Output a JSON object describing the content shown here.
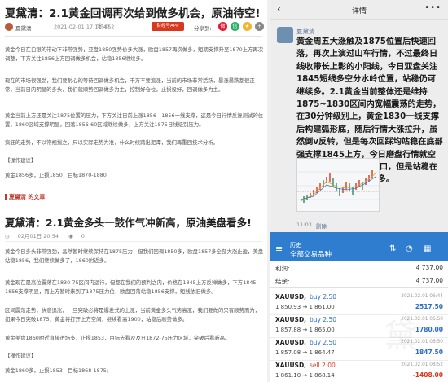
{
  "article1": {
    "title": "夏黛清：2.1黄金回调再次给到做多机会，原油待空!",
    "author": "夏黛清",
    "date": "2021-02-01 17:12:47",
    "views": "452",
    "app_button": "财经号APP",
    "share_label": "分享到:",
    "paragraphs": [
      "黄金今日在白银的带动下非常强势，亚盘1850强势价多大涨，欧盘1857再次做多，短期支撑升至1870上方再次调整，下方关注1856上方回调做多机会，站稳1856继续多。",
      "现在的市场很强劲，我们要耐心的等待回调做多机会，千万不要追涨，当前的市场非常活跃，暴涨暴跌都很正常，当前日内明显的多头，我们就顺势回调做多为主，控制好仓位，止损设好，回调做多为主。",
      "黄金当前上方还是关注1875位置的压力，下方关注日前上涨1856—1856一线支撑，这是今日行情反复测试的位置，1860区域支撑明显，回落1856-60区域继续做多，上方关注1875日线级别压力。",
      "疯狂的走势，不以常规揣之，只以实际走势为准，什么时候踏出泥潭，我们再重回技术分析。",
      "【操作建议】",
      "黄金1856多，止损1850，目标1870-1880；"
    ]
  },
  "section_header": "夏黛清 的文章",
  "article2": {
    "title": "夏黛清：2.1黄金多头一鼓作气冲新高，原油美盘看多!",
    "date": "02月01日 20:54",
    "views": "0",
    "paragraphs": [
      "黄金今日多头非常强劲，晶然暂时继续保持在1875压力，但我们回调1850多，欧盘1857多全部大涨止盈，美盘站稳1856，我们继续做多了，1860附近多。",
      "黄金现在是高位震荡在1830-75区间内运行，但都在我们的预判之内，价格在1845上方反弹做多，下方1845—1856支撑明显，而上方暂时来到了1875压力位，欧盘回落站稳1856支撑，短线依旧做多。",
      "区间震荡走势，执意追涨，一旦突破必将是爆发式的上涨，当前黄金多头气势高涨，我们要做的只有顺势而为，如果今日突破1875，黄金将打开上方空间，继续看高1900，站稳后顺势做多。",
      "黄金美盘1860附近直接进场多，止损1853，目标先看及及日1872-75压力区域，突破后看新高。",
      "【操作建议】",
      "黄金1860多，止损1853，目标1868-1875;"
    ]
  },
  "detail": {
    "title": "详情",
    "back_icon": "back-arrow-icon",
    "more_icon": "more-dots-icon",
    "poster": "夏黛清",
    "message": "黄金周五大涨触及1875位置后快速回落，再次上演过山车行情，不过最终日线收带长上影的小阳线，今日亚盘关注1845短线多空分水岭位置，站稳仍可继续多。2.1黄金当前整体还是维持1875~1830区间内宽幅震荡的走势，在30分钟级别上，黄金1830一线支撑后构建弧形底，随后行情大涨拉升，虽然倒v反转，但是每次回踩均站稳在底部强支撑1845上方，今日磨盘行情就空高开后回落尝试回补缺口，但是站稳在1845位置还是继续做多。",
    "time": "11:03",
    "delete_label": "删除"
  },
  "trading": {
    "header_top": "历史",
    "header_main": "全部交易品种",
    "summary": [
      {
        "label": "利润:",
        "value": "4 737.00"
      },
      {
        "label": "结余:",
        "value": "4 737.00"
      }
    ],
    "trades": [
      {
        "symbol": "XAUUSD,",
        "side": "buy 2.50",
        "datetime": "2021.02.01 06:44",
        "prices": "1 850.93 → 1 861.00",
        "pnl": "2517.50",
        "pnl_color": "#2f6fc5"
      },
      {
        "symbol": "XAUUSD,",
        "side": "buy 2.50",
        "datetime": "2021.02.01 06:50",
        "prices": "1 857.88 → 1 865.00",
        "pnl": "1780.00",
        "pnl_color": "#2f6fc5"
      },
      {
        "symbol": "XAUUSD,",
        "side": "buy 2.50",
        "datetime": "2021.02.01 06:50",
        "prices": "1 857.08 → 1 864.47",
        "pnl": "1847.50",
        "pnl_color": "#2f6fc5"
      },
      {
        "symbol": "XAUUSD,",
        "side": "sell 2.00",
        "datetime": "2021.02.01 08:52",
        "prices": "1 861.10 → 1 868.14",
        "pnl": "-1408.00",
        "pnl_color": "#d9381e"
      }
    ],
    "sell_color": "#d9381e",
    "buy_color": "#2f6fc5",
    "header_color": "#2f7dcf"
  }
}
